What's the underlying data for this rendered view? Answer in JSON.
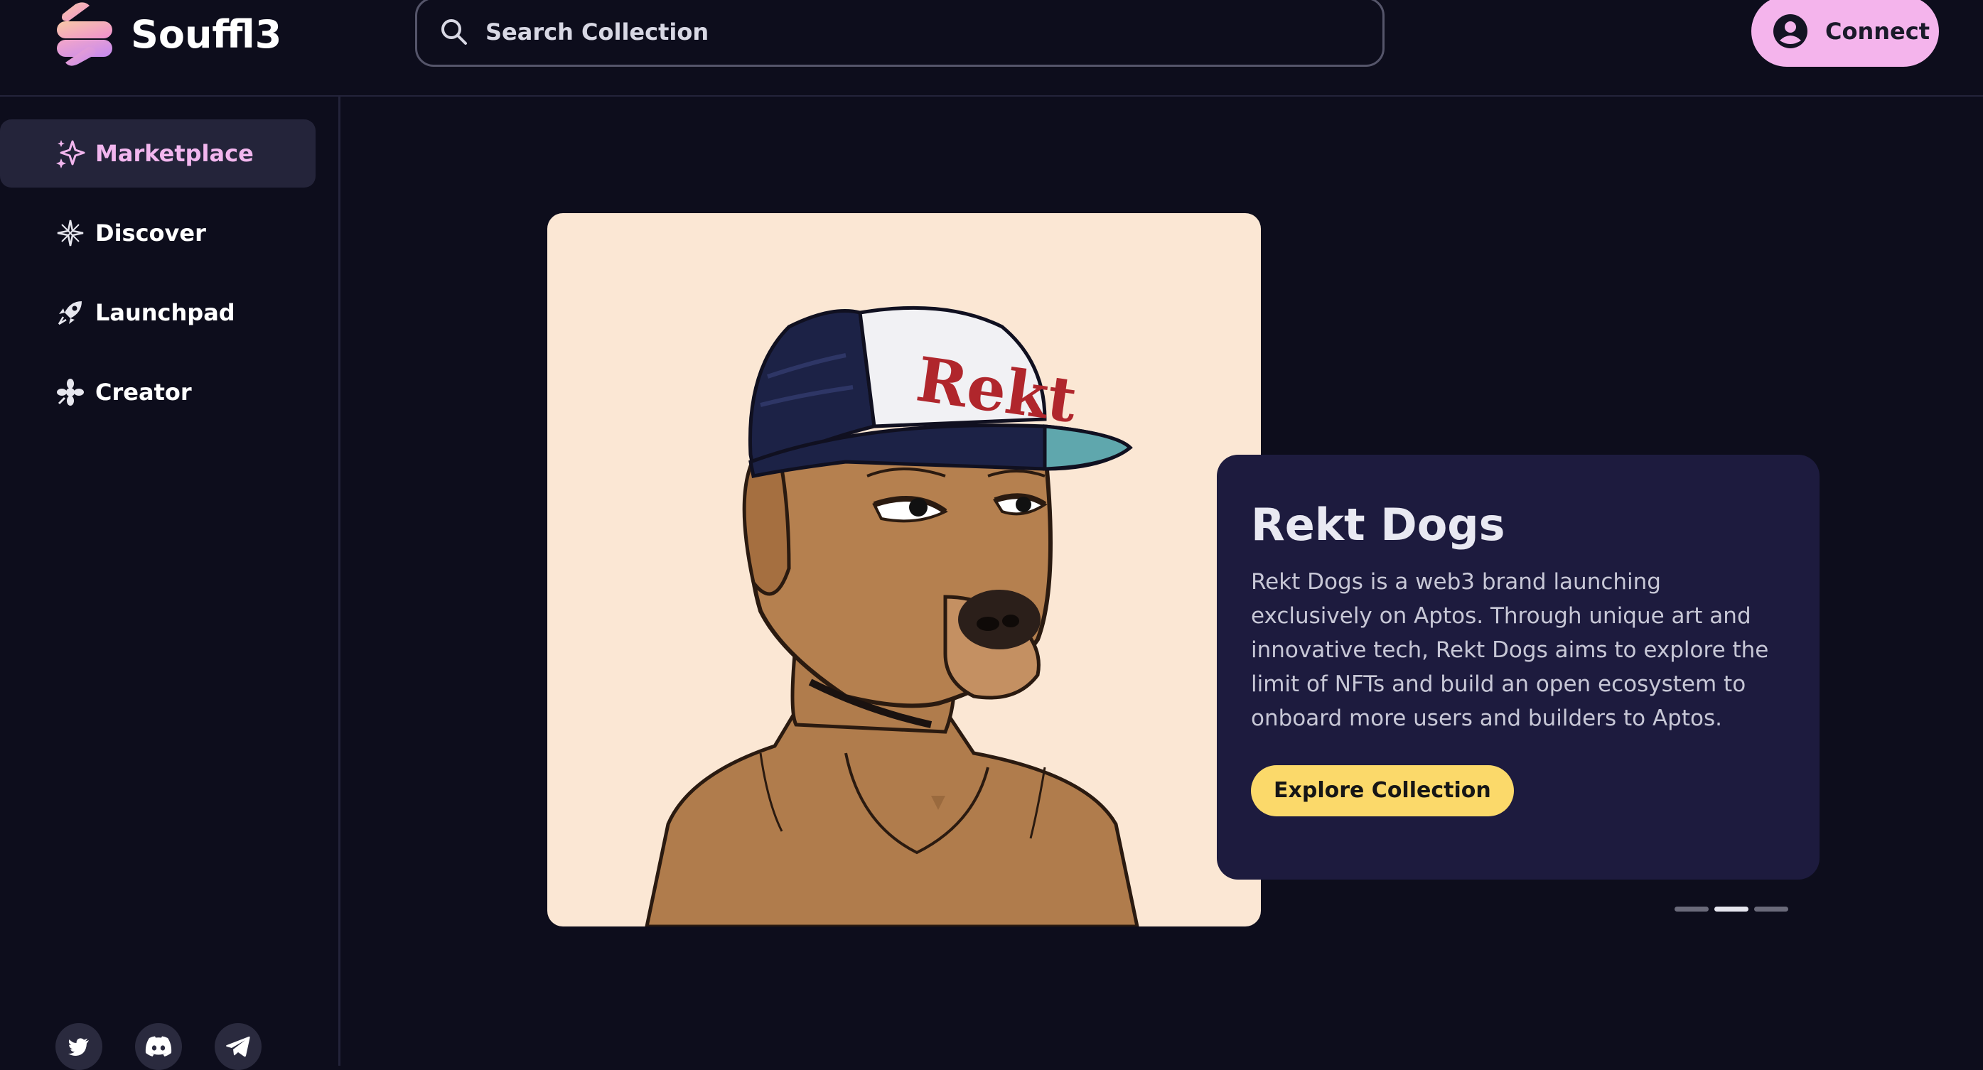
{
  "app": {
    "name": "Souffl3"
  },
  "header": {
    "search_placeholder": "Search Collection",
    "connect_label": "Connect"
  },
  "sidebar": {
    "items": [
      {
        "label": "Marketplace",
        "icon": "sparkles-icon",
        "active": true
      },
      {
        "label": "Discover",
        "icon": "compass-star-icon",
        "active": false
      },
      {
        "label": "Launchpad",
        "icon": "rocket-icon",
        "active": false
      },
      {
        "label": "Creator",
        "icon": "creator-icon",
        "active": false
      }
    ],
    "socials": [
      "twitter-icon",
      "discord-icon",
      "telegram-icon"
    ]
  },
  "featured": {
    "title": "Rekt Dogs",
    "description": "Rekt Dogs is a web3 brand launching exclusively on Aptos. Through unique art and innovative tech, Rekt Dogs aims to explore the limit of NFTs and build an open ecosystem to onboard more users and builders to Aptos.",
    "cta_label": "Explore Collection",
    "image_cap_text": "Rekt",
    "carousel": {
      "count": 3,
      "active_index": 1
    }
  },
  "colors": {
    "background": "#0d0d1c",
    "accent_pink": "#f4b4ec",
    "card_bg": "#1d1b3e",
    "cta_yellow": "#fbd96a"
  }
}
